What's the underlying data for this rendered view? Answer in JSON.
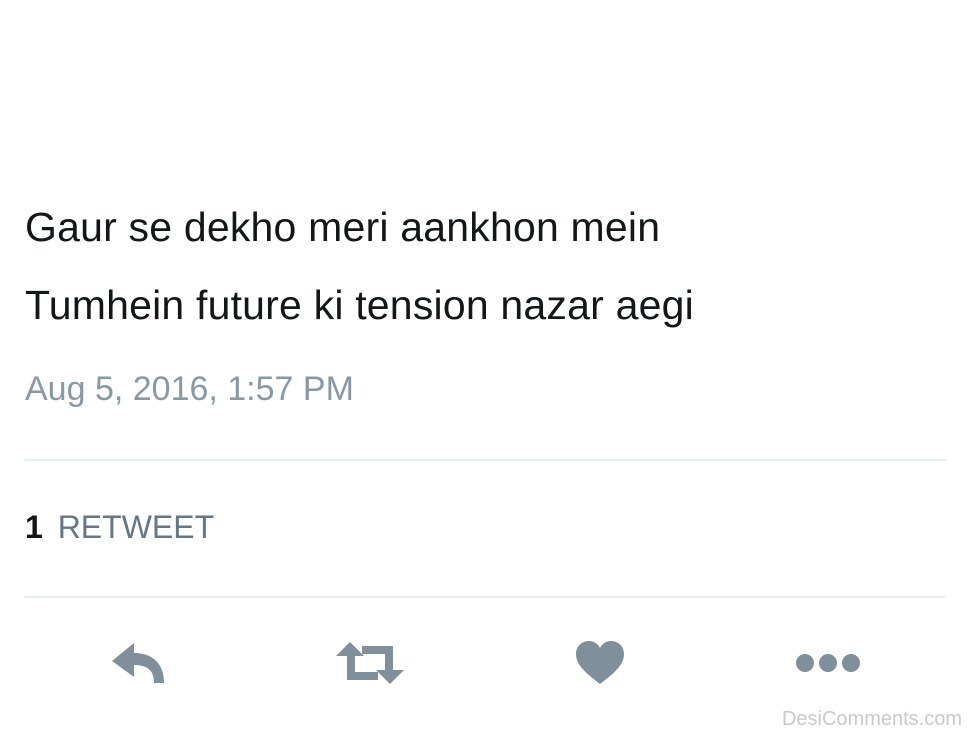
{
  "tweet": {
    "text_lines": [
      "Gaur se dekho meri aankhon mein",
      "Tumhein future ki tension nazar aegi"
    ],
    "timestamp": "Aug 5, 2016, 1:57 PM"
  },
  "stats": {
    "retweet_count": "1",
    "retweet_label": "RETWEET"
  },
  "actions": [
    {
      "name": "reply",
      "icon": "reply-icon"
    },
    {
      "name": "retweet",
      "icon": "retweet-icon"
    },
    {
      "name": "like",
      "icon": "heart-icon"
    },
    {
      "name": "more",
      "icon": "more-dots-icon"
    }
  ],
  "colors": {
    "text": "#14171a",
    "muted": "#8899a6",
    "icon": "#7f8f9c",
    "divider": "#e6ecf0"
  },
  "watermark": "DesiComments.com"
}
